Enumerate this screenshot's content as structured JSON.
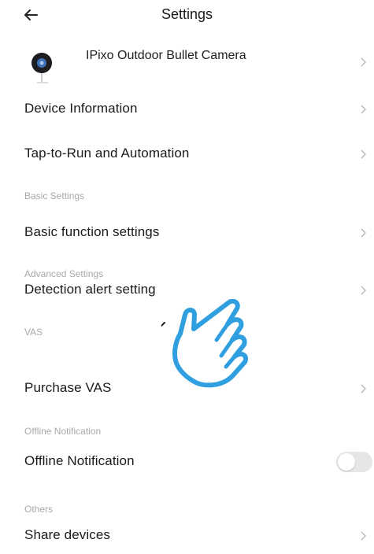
{
  "header": {
    "title": "Settings",
    "back_icon": "arrow-left-icon"
  },
  "device": {
    "name": "IPixo Outdoor Bullet Camera",
    "thumbnail_icon": "security-camera-icon"
  },
  "rows": {
    "device_information": "Device Information",
    "tap_to_run": "Tap-to-Run and Automation",
    "basic_function": "Basic function settings",
    "detection_alert": "Detection alert setting",
    "purchase_vas": "Purchase VAS",
    "offline_notification": "Offline Notification",
    "share_devices": "Share devices"
  },
  "sections": {
    "basic": "Basic Settings",
    "advanced": "Advanced Settings",
    "vas": "VAS",
    "offline": "Offline Notification",
    "others": "Others"
  },
  "toggles": {
    "offline_notification_on": false
  },
  "overlay": {
    "icon": "pointing-hand-icon",
    "color": "#2f9fe0"
  }
}
